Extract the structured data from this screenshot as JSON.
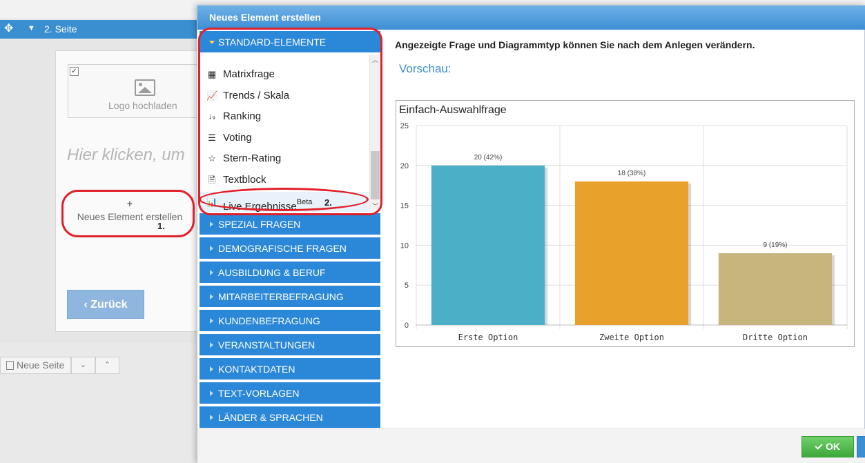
{
  "background": {
    "page_name": "2. Seite",
    "logo_upload_label": "Logo hochladen",
    "click_hint": "Hier klicken, um",
    "new_element_label": "Neues Element erstellen",
    "back_button": "Zurück",
    "new_page_button": "Neue Seite"
  },
  "annotations": {
    "step1": "1.",
    "step2": "2."
  },
  "dialog": {
    "title": "Neues Element erstellen",
    "categories": {
      "standard": "STANDARD-ELEMENTE",
      "spezial": "SPEZIAL FRAGEN",
      "demografisch": "DEMOGRAFISCHE FRAGEN",
      "ausbildung": "AUSBILDUNG & BERUF",
      "mitarbeiter": "MITARBEITERBEFRAGUNG",
      "kunden": "KUNDENBEFRAGUNG",
      "veranstaltungen": "VERANSTALTUNGEN",
      "kontakt": "KONTAKTDATEN",
      "textvorlagen": "TEXT-VORLAGEN",
      "laender": "LÄNDER & SPRACHEN"
    },
    "standard_items": {
      "matrix": "Matrixfrage",
      "trends": "Trends / Skala",
      "ranking": "Ranking",
      "voting": "Voting",
      "stern": "Stern-Rating",
      "textblock": "Textblock",
      "live": "Live Ergebnisse",
      "live_badge": "Beta"
    },
    "hint": "Angezeigte Frage und Diagrammtyp können Sie nach dem Anlegen verändern.",
    "preview_label": "Vorschau:",
    "ok_button": "OK"
  },
  "colors": {
    "dialog_accent": "#2b88d8",
    "ok_green": "#3ea83a",
    "annotation_red": "#e0202a"
  },
  "chart_data": {
    "type": "bar",
    "title": "Einfach-Auswahlfrage",
    "categories": [
      "Erste Option",
      "Zweite Option",
      "Dritte Option"
    ],
    "values": [
      20,
      18,
      9
    ],
    "data_labels": [
      "20 (42%)",
      "18 (38%)",
      "9 (19%)"
    ],
    "colors": [
      "#4bb0c7",
      "#e8a12b",
      "#c8b47d"
    ],
    "ylim": [
      0,
      25
    ],
    "yticks": [
      0,
      5,
      10,
      15,
      20,
      25
    ],
    "grid": true
  }
}
